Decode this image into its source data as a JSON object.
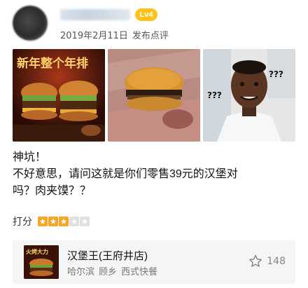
{
  "post": {
    "username": "user",
    "level": "Lv4",
    "date": "2019年2月11日",
    "action": "发布点评"
  },
  "photos": {
    "promo_text": "新年整个年排"
  },
  "meme": {
    "question_marks": "???"
  },
  "review": {
    "line1": "神坑！",
    "line2": "不好意思，请问这就是你们零售39元的汉堡对",
    "line3": "吗？肉夹馍？？"
  },
  "rating": {
    "label": "打分",
    "value": 3,
    "max": 5,
    "filled_color": "#f5a623",
    "empty_color": "#e0e0e0"
  },
  "shop": {
    "name": "汉堡王(王府井店)",
    "city": "哈尔滨",
    "district": "顾乡",
    "category": "西式快餐",
    "favorite_count": "148",
    "thumb_text": "火烤大力"
  },
  "colors": {
    "level_badge": "#ffc21a",
    "card_bg": "#f5f5f5"
  }
}
